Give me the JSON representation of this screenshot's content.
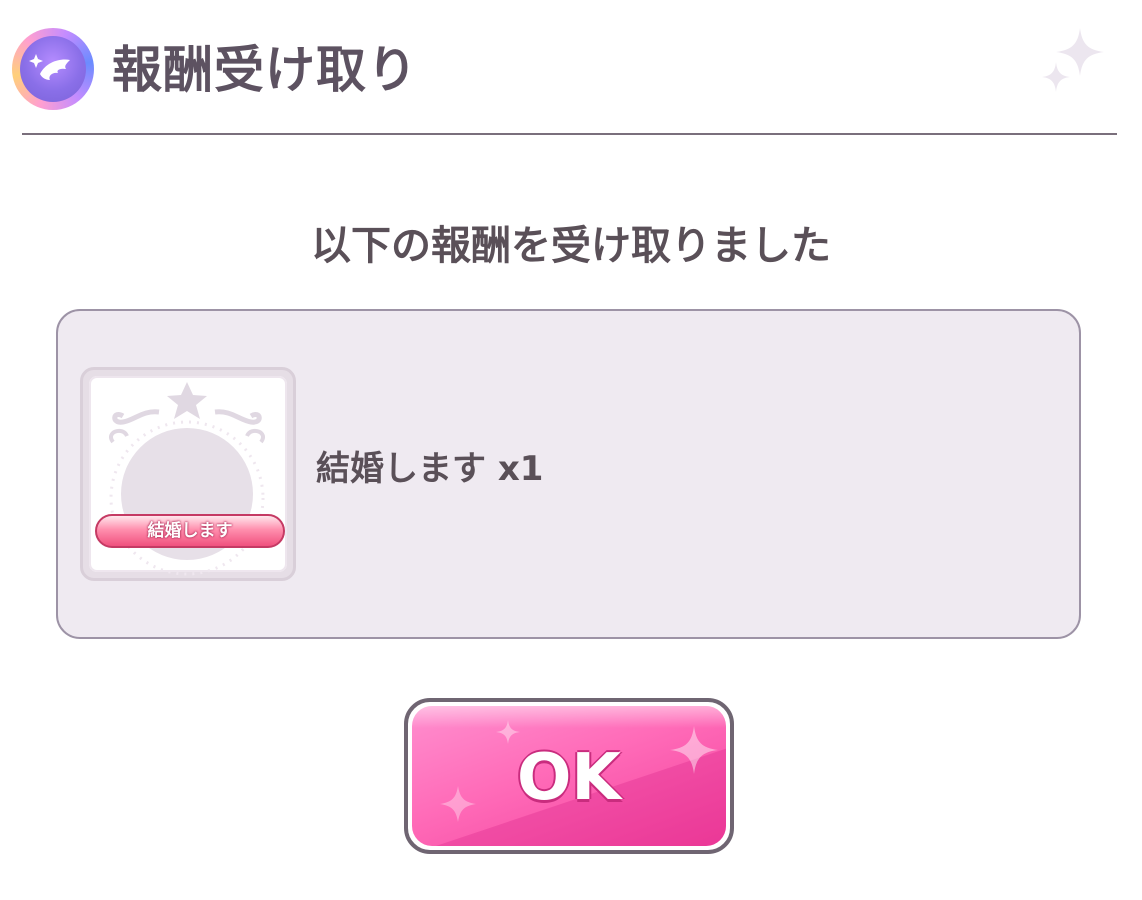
{
  "header": {
    "title": "報酬受け取り",
    "icon": "wing-badge-icon",
    "decoration": "sparkle-icon"
  },
  "message": "以下の報酬を受け取りました",
  "rewards": [
    {
      "icon": "marriage-item-icon",
      "icon_label": "結婚します",
      "name": "結婚します x1"
    }
  ],
  "ok_button": {
    "label": "OK"
  },
  "colors": {
    "accent_pink": "#f2409c",
    "text": "#5a5058",
    "panel": "#efeaf1"
  }
}
